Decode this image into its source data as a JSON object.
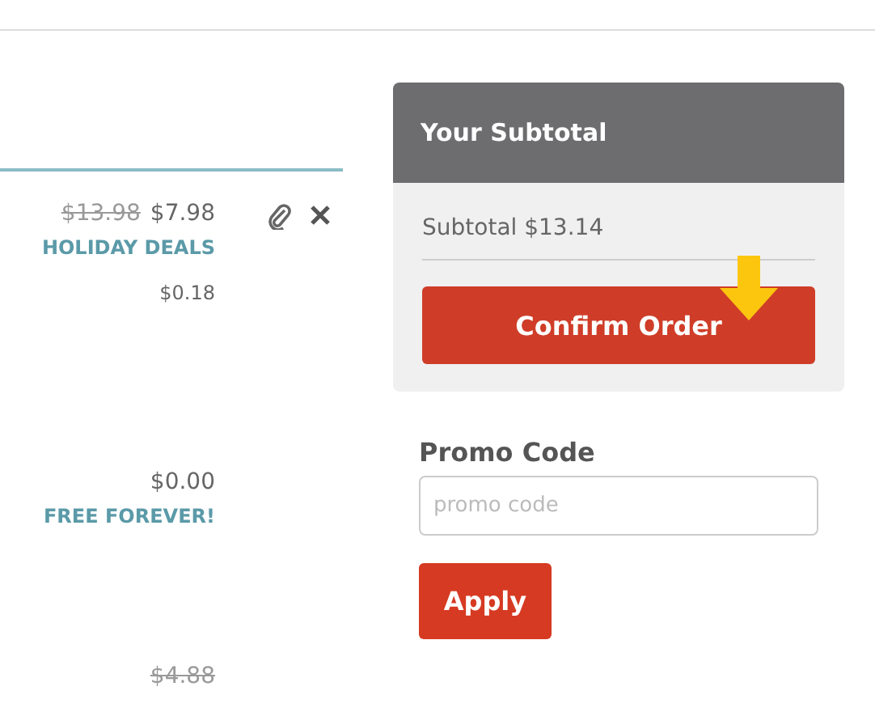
{
  "cart": {
    "items": [
      {
        "old_price": "$13.98",
        "price": "$7.98",
        "deal": "HOLIDAY DEALS",
        "fee": "$0.18",
        "actions": true
      },
      {
        "price": "$0.00",
        "deal": "FREE FOREVER!",
        "actions": false
      },
      {
        "old_price": "$4.88",
        "actions": false
      }
    ]
  },
  "summary": {
    "title": "Your Subtotal",
    "subtotal": "Subtotal $13.14",
    "button": "Confirm Order"
  },
  "promo": {
    "label": "Promo Code",
    "placeholder": "promo code",
    "button": "Apply"
  }
}
